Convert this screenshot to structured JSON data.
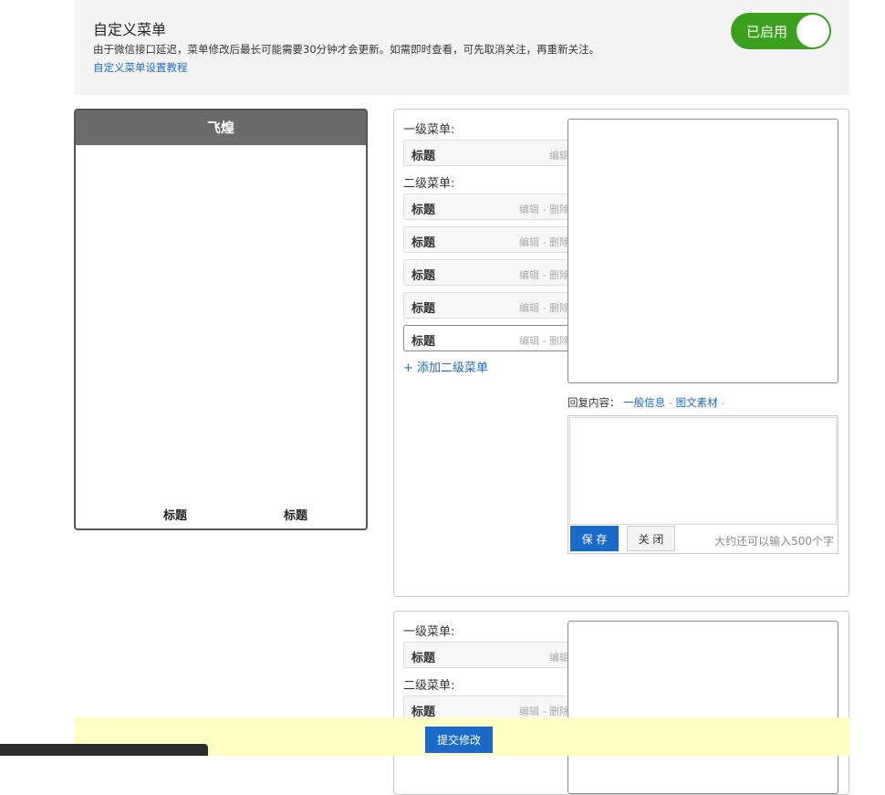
{
  "header": {
    "title": "自定义菜单",
    "description": "由于微信接口延迟，菜单修改后最长可能需要30分钟才会更新。如需即时查看，可先取消关注，再重新关注。",
    "tutorial_link": "自定义菜单设置教程",
    "toggle_label": "已启用"
  },
  "phone": {
    "account_name": "飞煌",
    "menu_items": [
      "标题",
      "标题"
    ]
  },
  "panel1": {
    "level1_label": "一级菜单:",
    "level1_item": {
      "title": "标题",
      "actions": "编辑"
    },
    "level2_label": "二级菜单:",
    "level2_items": [
      {
        "title": "标题",
        "actions": "编辑 - 删除"
      },
      {
        "title": "标题",
        "actions": "编辑 - 删除"
      },
      {
        "title": "标题",
        "actions": "编辑 - 删除"
      },
      {
        "title": "标题",
        "actions": "编辑 - 删除"
      },
      {
        "title": "标题",
        "actions": "编辑 - 删除"
      }
    ],
    "add_submenu": "+ 添加二级菜单",
    "reply_label": "回复内容：",
    "reply_link_general": "一般信息",
    "reply_link_media": "图文素材",
    "save_label": "保 存",
    "close_label": "关 闭",
    "counter_text": "大约还可以输入500个字"
  },
  "panel2": {
    "level1_label": "一级菜单:",
    "level1_item": {
      "title": "标题",
      "actions": "编辑"
    },
    "level2_label": "二级菜单:",
    "level2_item": {
      "title": "标题",
      "actions": "编辑 - 删除"
    }
  },
  "footer": {
    "submit_label": "提交修改"
  },
  "colors": {
    "accent": "#1b6ac9",
    "toggle_on": "#3ba01e",
    "footer_bg": "#fdfdc4"
  }
}
